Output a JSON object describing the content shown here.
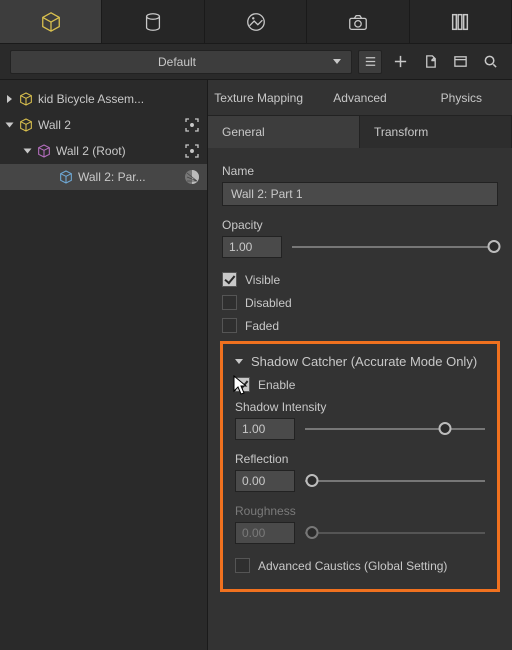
{
  "toolbar": {
    "preset_label": "Default"
  },
  "tree": {
    "items": [
      {
        "label": "kid Bicycle Assem..."
      },
      {
        "label": "Wall 2"
      },
      {
        "label": "Wall 2 (Root)"
      },
      {
        "label": "Wall 2: Par..."
      }
    ]
  },
  "panel": {
    "tabs1": {
      "texture": "Texture Mapping",
      "advanced": "Advanced",
      "physics": "Physics"
    },
    "tabs2": {
      "general": "General",
      "transform": "Transform"
    },
    "name_label": "Name",
    "name_value": "Wall 2: Part 1",
    "opacity_label": "Opacity",
    "opacity_value": "1.00",
    "visible_label": "Visible",
    "disabled_label": "Disabled",
    "faded_label": "Faded",
    "sc": {
      "title": "Shadow Catcher (Accurate Mode Only)",
      "enable_label": "Enable",
      "shadow_intensity_label": "Shadow Intensity",
      "shadow_intensity_value": "1.00",
      "reflection_label": "Reflection",
      "reflection_value": "0.00",
      "roughness_label": "Roughness",
      "roughness_value": "0.00",
      "advanced_caustics_label": "Advanced Caustics (Global Setting)"
    }
  },
  "colors": {
    "accent": "#d9c04e",
    "highlight": "#f0711f"
  }
}
